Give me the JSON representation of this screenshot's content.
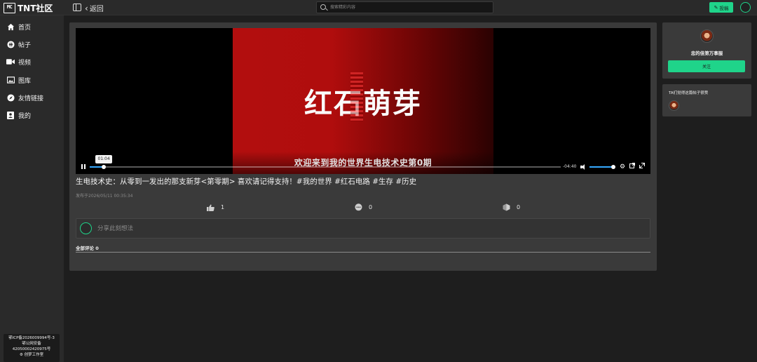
{
  "header": {
    "logo_mark": "MC",
    "logo_text": "TNT社区",
    "back_label": "返回",
    "search_placeholder": "搜索精彩内容",
    "post_label": "投稿"
  },
  "sidebar": {
    "items": [
      {
        "label": "首页",
        "icon": "home-icon"
      },
      {
        "label": "帖子",
        "icon": "posts-icon"
      },
      {
        "label": "视频",
        "icon": "video-icon"
      },
      {
        "label": "图库",
        "icon": "gallery-icon"
      },
      {
        "label": "友情链接",
        "icon": "compass-icon"
      },
      {
        "label": "我的",
        "icon": "profile-icon"
      }
    ],
    "footer": {
      "icp": "鄂ICP备2026009994号-3",
      "police": "鄂公网安备",
      "police_no": "42050002420975号",
      "studio": "⚙ 创梦工作室"
    }
  },
  "video": {
    "frame_title": "红石萌芽",
    "frame_subtitle": "欢迎来到我的世界生电技术史第0期",
    "hover_time": "01:04",
    "remaining": "-04:40",
    "progress": 0.03,
    "volume": 0.95,
    "accent_color": "#36a9ff"
  },
  "post": {
    "title": "生电技术史：从零到一发出的那支新芽<第零期> 喜欢请记得支持！#我的世界 #红石电路 #生存 #历史",
    "published": "发布于2026/05/11 00:35:34",
    "likes": "1",
    "comments": "0",
    "shares": "0"
  },
  "comment": {
    "placeholder": "分享此刻想法",
    "all_label": "全部评论 0"
  },
  "author": {
    "name": "忠的佳第万事服",
    "follow_label": "关注"
  },
  "likers": {
    "title": "TA们觉得这篇帖子很赞"
  },
  "colors": {
    "accent_green": "#1fd48a",
    "background": "#1e1e1e",
    "panel": "#3a3a3a"
  }
}
